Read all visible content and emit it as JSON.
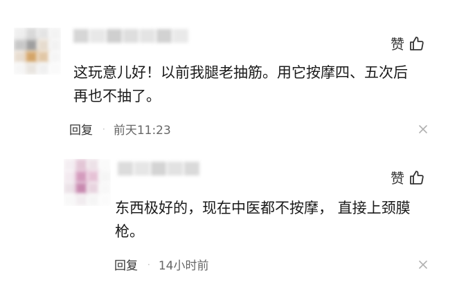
{
  "comments": [
    {
      "like_label": "赞",
      "content_lines": [
        "这玩意儿好！以前我腿老抽筋。用它按摩四、五次后",
        "再也不抽了。"
      ],
      "reply_label": "回复",
      "separator": "·",
      "time": "前天11:23",
      "like_icon": "thumbs-up-icon",
      "close_icon": "close-icon",
      "avatar_colors": [
        "#efefef",
        "#d9d9d9",
        "#e4e4e4",
        "#f3f3f3",
        "#c8c8c8",
        "#9f9f9f",
        "#e6dccf",
        "#f2f2f2",
        "#e8ddd0",
        "#d4a56a",
        "#e1c7a6",
        "#f5f5f5",
        "#f6f6f6",
        "#e9e5e0",
        "#f0f0f0",
        "#fafafa"
      ],
      "username_colors": [
        "#d6d6d6",
        "#e8e8e8",
        "#cfcfcf",
        "#dedede",
        "#e4e4e4",
        "#d2d2d2",
        "#e9e9e9"
      ]
    },
    {
      "like_label": "赞",
      "content_lines": [
        "东西极好的，现在中医都不按摩， 直接上颈膜",
        "枪。"
      ],
      "reply_label": "回复",
      "separator": "·",
      "time": "14小时前",
      "like_icon": "thumbs-up-icon",
      "close_icon": "close-icon",
      "avatar_colors": [
        "#f4eef2",
        "#e3c6d6",
        "#ede2e8",
        "#fafafa",
        "#f3eaf0",
        "#d49bbd",
        "#e6c2d6",
        "#f5f5f5",
        "#ece2e8",
        "#c88ab0",
        "#e8d4df",
        "#f7f7f7",
        "#f8f8f8",
        "#f1ecef",
        "#f5f5f5",
        "#fbfbfb"
      ],
      "username_colors": [
        "#dcdcdc",
        "#e6e6e6",
        "#d4d4d4",
        "#e2e2e2",
        "#dadada"
      ]
    }
  ]
}
